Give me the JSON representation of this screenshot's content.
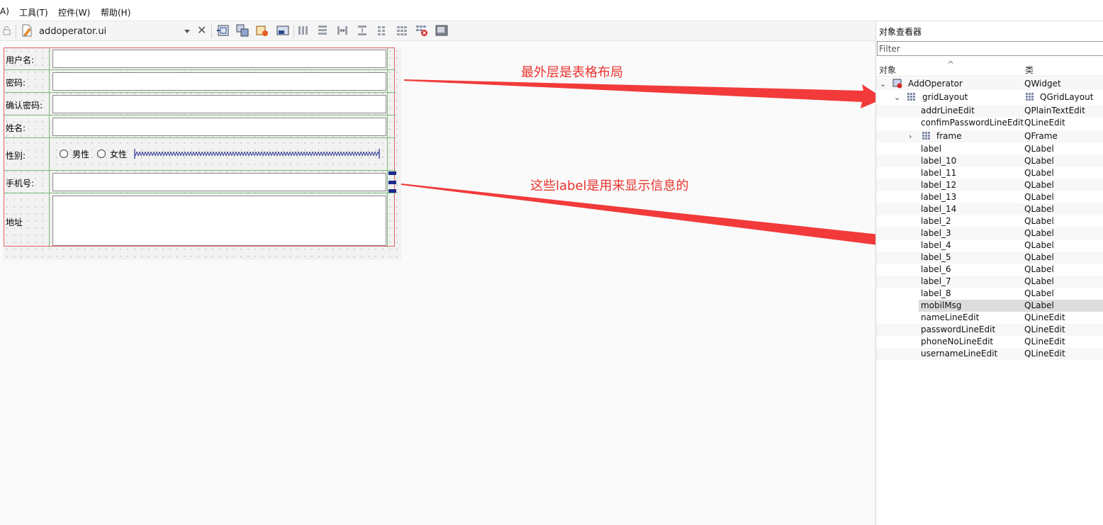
{
  "menubar": {
    "items": [
      "A)",
      "工具(T)",
      "控件(W)",
      "帮助(H)"
    ]
  },
  "toolbar": {
    "file_name": "addoperator.ui",
    "icons": [
      "lock-icon",
      "file-edit-icon",
      "close-icon",
      "widget-editing-icon",
      "signal-slot-editing-icon",
      "buddy-editing-icon",
      "tab-order-editing-icon",
      "layout-horizontal-icon",
      "layout-vertical-icon",
      "layout-horizontal-splitter-icon",
      "layout-vertical-splitter-icon",
      "layout-form-icon",
      "layout-grid-icon",
      "break-layout-icon",
      "adjust-size-icon"
    ]
  },
  "form": {
    "labels": {
      "username": "用户名:",
      "password": "密码:",
      "confirm": "确认密码:",
      "name": "姓名:",
      "gender": "性别:",
      "phone": "手机号:",
      "address": "地址"
    },
    "gender_options": {
      "male": "男性",
      "female": "女性"
    }
  },
  "annotations": {
    "top": "最外层是表格布局",
    "bottom": "这些label是用来显示信息的"
  },
  "annotation_color": "#e8332f",
  "bracket_color": "#1e9be8",
  "inspector": {
    "title": "对象查看器",
    "filter_placeholder": "Filter",
    "col_object": "对象",
    "col_class": "类",
    "sort_indicator": "^",
    "rows": [
      {
        "name": "AddOperator",
        "cls": "QWidget"
      },
      {
        "name": "gridLayout",
        "cls": "QGridLayout"
      },
      {
        "name": "addrLineEdit",
        "cls": "QPlainTextEdit"
      },
      {
        "name": "confimPasswordLineEdit",
        "cls": "QLineEdit"
      },
      {
        "name": "frame",
        "cls": "QFrame"
      },
      {
        "name": "label",
        "cls": "QLabel"
      },
      {
        "name": "label_10",
        "cls": "QLabel"
      },
      {
        "name": "label_11",
        "cls": "QLabel"
      },
      {
        "name": "label_12",
        "cls": "QLabel"
      },
      {
        "name": "label_13",
        "cls": "QLabel"
      },
      {
        "name": "label_14",
        "cls": "QLabel"
      },
      {
        "name": "label_2",
        "cls": "QLabel"
      },
      {
        "name": "label_3",
        "cls": "QLabel"
      },
      {
        "name": "label_4",
        "cls": "QLabel"
      },
      {
        "name": "label_5",
        "cls": "QLabel"
      },
      {
        "name": "label_6",
        "cls": "QLabel"
      },
      {
        "name": "label_7",
        "cls": "QLabel"
      },
      {
        "name": "label_8",
        "cls": "QLabel"
      },
      {
        "name": "mobilMsg",
        "cls": "QLabel"
      },
      {
        "name": "nameLineEdit",
        "cls": "QLineEdit"
      },
      {
        "name": "passwordLineEdit",
        "cls": "QLineEdit"
      },
      {
        "name": "phoneNoLineEdit",
        "cls": "QLineEdit"
      },
      {
        "name": "usernameLineEdit",
        "cls": "QLineEdit"
      }
    ]
  }
}
